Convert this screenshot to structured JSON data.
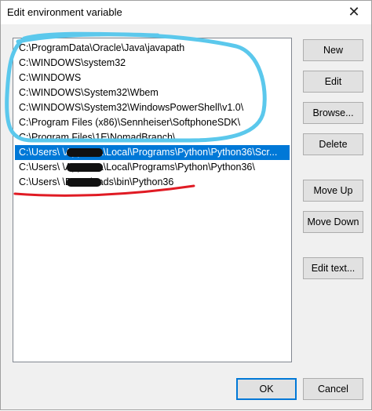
{
  "window": {
    "title": "Edit environment variable",
    "close_glyph": "✕"
  },
  "list": {
    "rows": [
      {
        "text": "C:\\ProgramData\\Oracle\\Java\\javapath",
        "selected": false
      },
      {
        "text": "C:\\WINDOWS\\system32",
        "selected": false
      },
      {
        "text": "C:\\WINDOWS",
        "selected": false
      },
      {
        "text": "C:\\WINDOWS\\System32\\Wbem",
        "selected": false
      },
      {
        "text": "C:\\WINDOWS\\System32\\WindowsPowerShell\\v1.0\\",
        "selected": false
      },
      {
        "text": "C:\\Program Files (x86)\\Sennheiser\\SoftphoneSDK\\",
        "selected": false
      },
      {
        "text": "C:\\Program Files\\1E\\NomadBranch\\",
        "selected": false
      },
      {
        "text": "C:\\Users\\          \\AppData\\Local\\Programs\\Python\\Python36\\Scr...",
        "selected": true
      },
      {
        "text": "C:\\Users\\          \\AppData\\Local\\Programs\\Python\\Python36\\",
        "selected": false
      },
      {
        "text": "C:\\Users\\          \\Downloads\\bin\\Python36",
        "selected": false
      }
    ]
  },
  "buttons": {
    "new": "New",
    "edit": "Edit",
    "browse": "Browse...",
    "delete": "Delete",
    "move_up": "Move Up",
    "move_down": "Move Down",
    "edit_text": "Edit text...",
    "ok": "OK",
    "cancel": "Cancel"
  },
  "colors": {
    "selection": "#0078d7",
    "annotation_blue": "#5bc8ec",
    "annotation_red": "#e01b24"
  }
}
